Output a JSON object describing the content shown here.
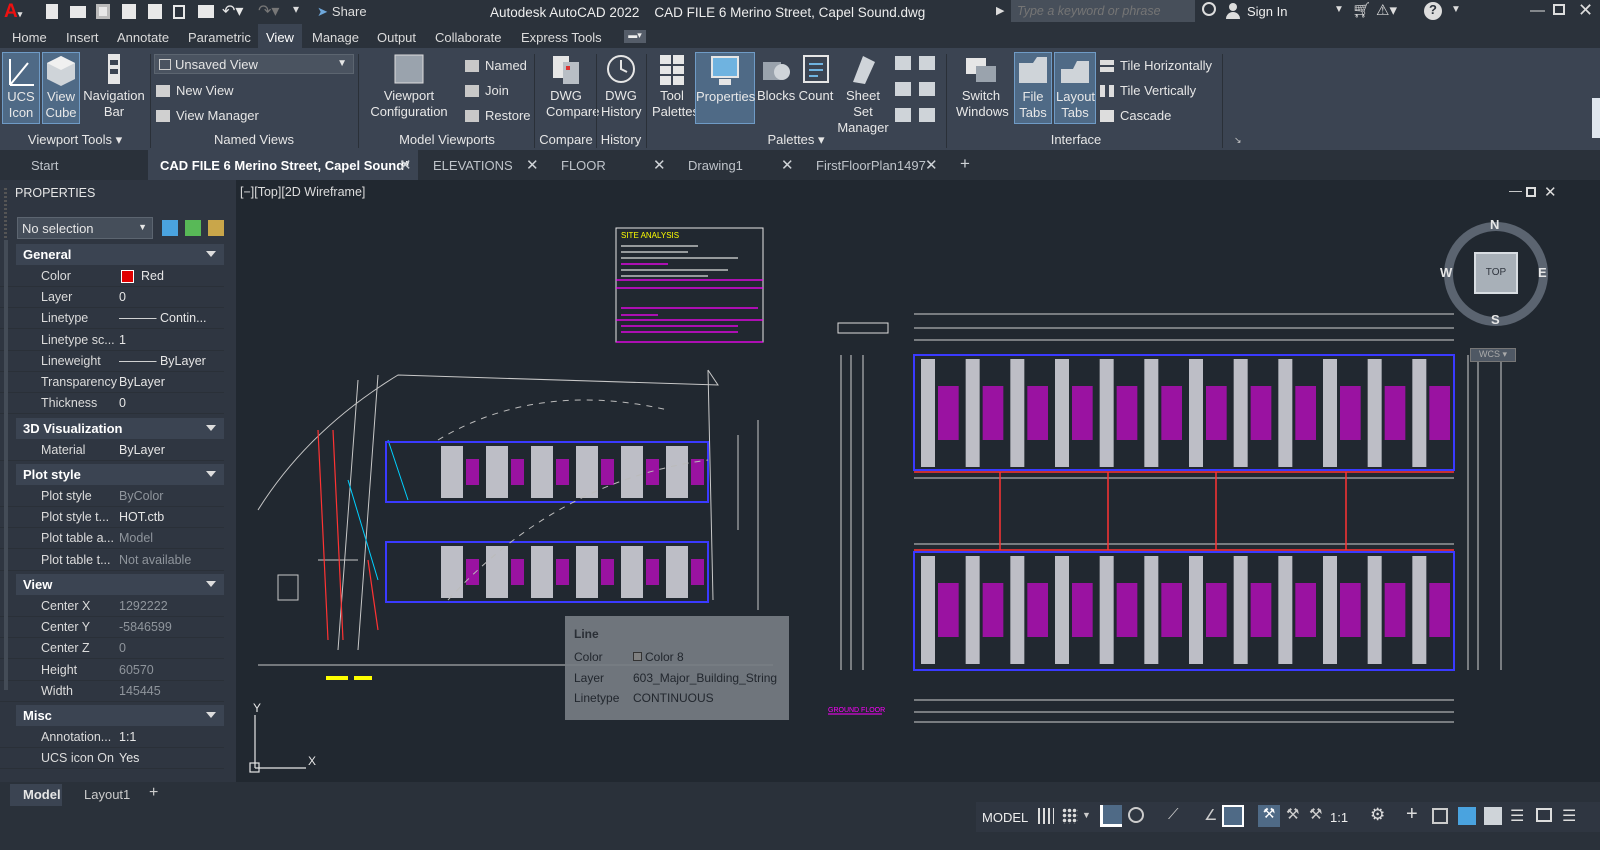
{
  "app": {
    "title": "Autodesk AutoCAD 2022",
    "file": "CAD FILE 6 Merino Street, Capel Sound.dwg",
    "share": "Share",
    "search_placeholder": "Type a keyword or phrase",
    "sign_in": "Sign In"
  },
  "ribbon_tabs": [
    "Home",
    "Insert",
    "Annotate",
    "Parametric",
    "View",
    "Manage",
    "Output",
    "Collaborate",
    "Express Tools"
  ],
  "ribbon": {
    "viewport_tools": {
      "label": "Viewport Tools",
      "ucs": "UCS Icon",
      "viewcube": "View Cube",
      "navbar": "Navigation Bar"
    },
    "named_views": {
      "label": "Named Views",
      "dropdown": "Unsaved View",
      "new_view": "New View",
      "view_manager": "View Manager"
    },
    "model_viewports": {
      "label": "Model Viewports",
      "config": "Viewport Configuration",
      "named": "Named",
      "join": "Join",
      "restore": "Restore"
    },
    "compare": {
      "label": "Compare",
      "dwg_compare": "DWG Compare"
    },
    "history": {
      "label": "History",
      "dwg_history": "DWG History"
    },
    "palettes": {
      "label": "Palettes",
      "tool_palettes": "Tool Palettes",
      "properties": "Properties",
      "blocks": "Blocks",
      "count": "Count",
      "sheet_set": "Sheet Set Manager"
    },
    "interface": {
      "label": "Interface",
      "switch_windows": "Switch Windows",
      "file_tabs": "File Tabs",
      "layout_tabs": "Layout Tabs",
      "tile_h": "Tile Horizontally",
      "tile_v": "Tile Vertically",
      "cascade": "Cascade"
    }
  },
  "doc_tabs": [
    "Start",
    "CAD FILE 6 Merino Street, Capel Sound*",
    "ELEVATIONS",
    "FLOOR",
    "Drawing1",
    "FirstFloorPlan1497"
  ],
  "properties": {
    "title": "PROPERTIES",
    "selection": "No selection",
    "general": {
      "label": "General",
      "rows": [
        [
          "Color",
          "Red"
        ],
        [
          "Layer",
          "0"
        ],
        [
          "Linetype",
          "——— Contin..."
        ],
        [
          "Linetype sc...",
          "1"
        ],
        [
          "Lineweight",
          "——— ByLayer"
        ],
        [
          "Transparency",
          "ByLayer"
        ],
        [
          "Thickness",
          "0"
        ]
      ]
    },
    "vis3d": {
      "label": "3D Visualization",
      "rows": [
        [
          "Material",
          "ByLayer"
        ]
      ]
    },
    "plot": {
      "label": "Plot style",
      "rows": [
        [
          "Plot style",
          "ByColor"
        ],
        [
          "Plot style t...",
          "HOT.ctb"
        ],
        [
          "Plot table a...",
          "Model"
        ],
        [
          "Plot table t...",
          "Not available"
        ]
      ]
    },
    "view": {
      "label": "View",
      "rows": [
        [
          "Center X",
          "1292222"
        ],
        [
          "Center Y",
          "-5846599"
        ],
        [
          "Center Z",
          "0"
        ],
        [
          "Height",
          "60570"
        ],
        [
          "Width",
          "145445"
        ]
      ]
    },
    "misc": {
      "label": "Misc",
      "rows": [
        [
          "Annotation...",
          "1:1"
        ],
        [
          "UCS icon On",
          "Yes"
        ]
      ]
    }
  },
  "viewport": {
    "label": "[−][Top][2D Wireframe]",
    "compass": {
      "n": "N",
      "s": "S",
      "e": "E",
      "w": "W",
      "top": "TOP",
      "wcs": "WCS"
    }
  },
  "drawing": {
    "site_title": "SITE ANALYSIS",
    "ground_floor": "GROUND FLOOR"
  },
  "tooltip": {
    "title": "Line",
    "rows": [
      [
        "Color",
        "Color 8"
      ],
      [
        "Layer",
        "603_Major_Building_String"
      ],
      [
        "Linetype",
        "CONTINUOUS"
      ]
    ]
  },
  "bottom": {
    "model_tab": "Model",
    "layout_tab": "Layout1",
    "status_model": "MODEL",
    "scale": "1:1"
  },
  "colors": {
    "accent": "#4f6a86",
    "magenta": "#ff00ff",
    "red": "#e00000",
    "yellow": "#ffff00"
  }
}
